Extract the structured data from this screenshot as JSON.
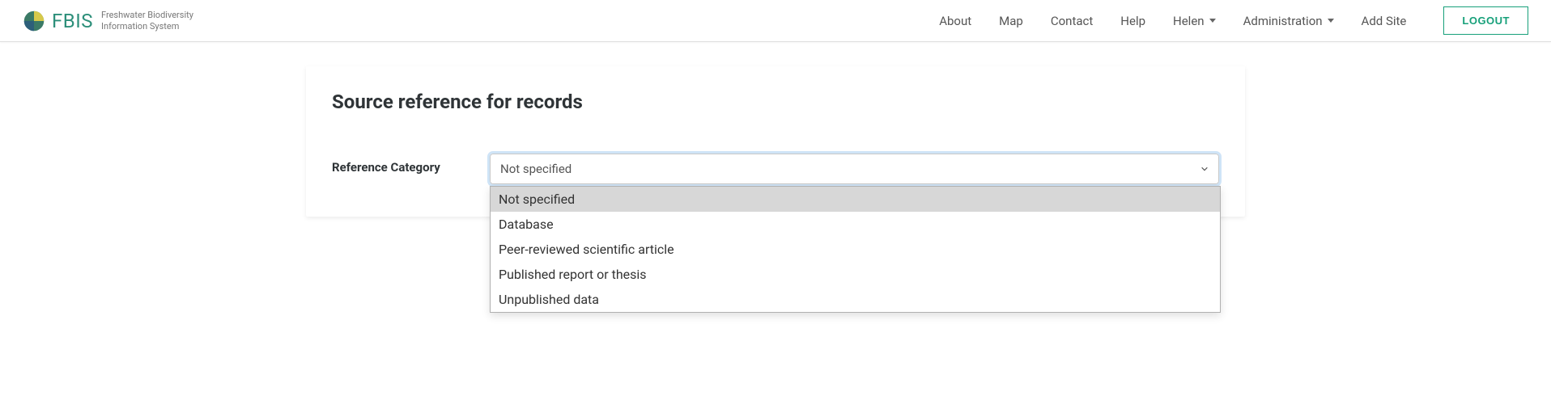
{
  "brand": {
    "name": "FBIS",
    "sub_line1": "Freshwater Biodiversity",
    "sub_line2": "Information System"
  },
  "nav": {
    "about": "About",
    "map": "Map",
    "contact": "Contact",
    "help": "Help",
    "user_name": "Helen",
    "administration": "Administration",
    "add_site": "Add Site",
    "logout": "LOGOUT"
  },
  "page": {
    "title": "Source reference for records",
    "form": {
      "reference_category_label": "Reference Category",
      "reference_category_selected": "Not specified",
      "reference_category_options": [
        "Not specified",
        "Database",
        "Peer-reviewed scientific article",
        "Published report or thesis",
        "Unpublished data"
      ]
    }
  },
  "colors": {
    "accent": "#17a07a",
    "brand_green": "#2d8f7a"
  }
}
